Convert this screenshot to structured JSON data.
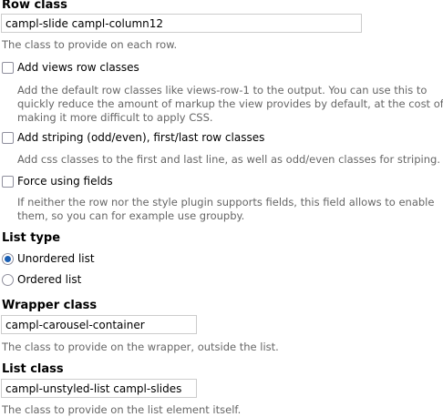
{
  "row_class": {
    "label": "Row class",
    "value": "campl-slide campl-column12",
    "description": "The class to provide on each row."
  },
  "add_views_row_classes": {
    "label": "Add views row classes",
    "checked": false,
    "description_lines": [
      "Add the default row classes like views-row-1 to the output. You can use this to",
      "quickly reduce the amount of markup the view provides by default, at the cost of",
      "making it more difficult to apply CSS."
    ]
  },
  "add_striping": {
    "label": "Add striping (odd/even), first/last row classes",
    "checked": false,
    "description": "Add css classes to the first and last line, as well as odd/even classes for striping."
  },
  "force_fields": {
    "label": "Force using fields",
    "checked": false,
    "description_lines": [
      "If neither the row nor the style plugin supports fields, this field allows to enable",
      "them, so you can for example use groupby."
    ]
  },
  "list_type": {
    "label": "List type",
    "options": [
      {
        "label": "Unordered list",
        "selected": true
      },
      {
        "label": "Ordered list",
        "selected": false
      }
    ]
  },
  "wrapper_class": {
    "label": "Wrapper class",
    "value": "campl-carousel-container",
    "description": "The class to provide on the wrapper, outside the list."
  },
  "list_class": {
    "label": "List class",
    "value": "campl-unstyled-list campl-slides",
    "description": "The class to provide on the list element itself."
  }
}
